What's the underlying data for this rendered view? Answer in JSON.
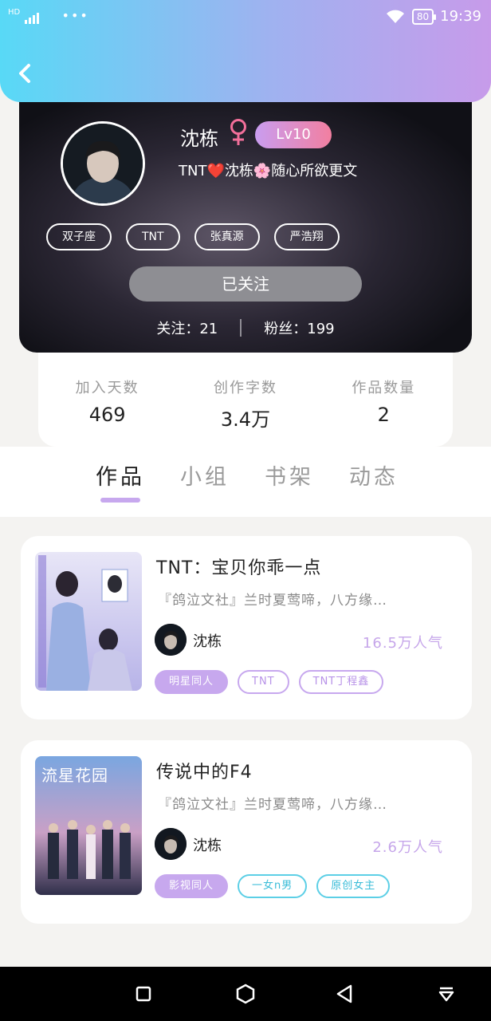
{
  "status_bar": {
    "left": "HD",
    "signal": "all",
    "dots": "•••",
    "battery": "80",
    "time": "19:39"
  },
  "header": {
    "back_icon": "chevron-left-icon"
  },
  "profile": {
    "name": "沈栋",
    "gender_icon": "female-symbol-icon",
    "level": "Lv10",
    "signature": "TNT❤️沈栋🌸随心所欲更文",
    "tags": [
      "双子座",
      "TNT",
      "张真源",
      "严浩翔"
    ],
    "follow_button": "已关注",
    "following": "关注：21",
    "fans": "粉丝：199"
  },
  "stats": [
    {
      "label": "加入天数",
      "value": "469"
    },
    {
      "label": "创作字数",
      "value": "3.4万"
    },
    {
      "label": "作品数量",
      "value": "2"
    }
  ],
  "tabs": [
    "作品",
    "小组",
    "书架",
    "动态"
  ],
  "works": [
    {
      "title": "TNT：宝贝你乖一点",
      "desc": "『鸽泣文社』兰时夏莺啼，八方缘…",
      "author": "沈栋",
      "popularity": "16.5万人气",
      "tags": [
        {
          "label": "明星同人",
          "style": "fill"
        },
        {
          "label": "TNT",
          "style": "purple"
        },
        {
          "label": "TNT丁程鑫",
          "style": "purple"
        }
      ]
    },
    {
      "title": "传说中的F4",
      "desc": "『鸽泣文社』兰时夏莺啼，八方缘…",
      "author": "沈栋",
      "popularity": "2.6万人气",
      "cover_text": "流星花园",
      "tags": [
        {
          "label": "影视同人",
          "style": "fill"
        },
        {
          "label": "一女n男",
          "style": "cyan"
        },
        {
          "label": "原创女主",
          "style": "cyan"
        }
      ]
    }
  ],
  "nav": {
    "recents": "square-icon",
    "home": "hexagon-icon",
    "back": "triangle-back-icon",
    "menu": "down-menu-icon"
  },
  "colors": {
    "accent": "#c7a8ee",
    "cyan": "#5ccfe6",
    "level_gradient_end": "#f27fa0"
  }
}
